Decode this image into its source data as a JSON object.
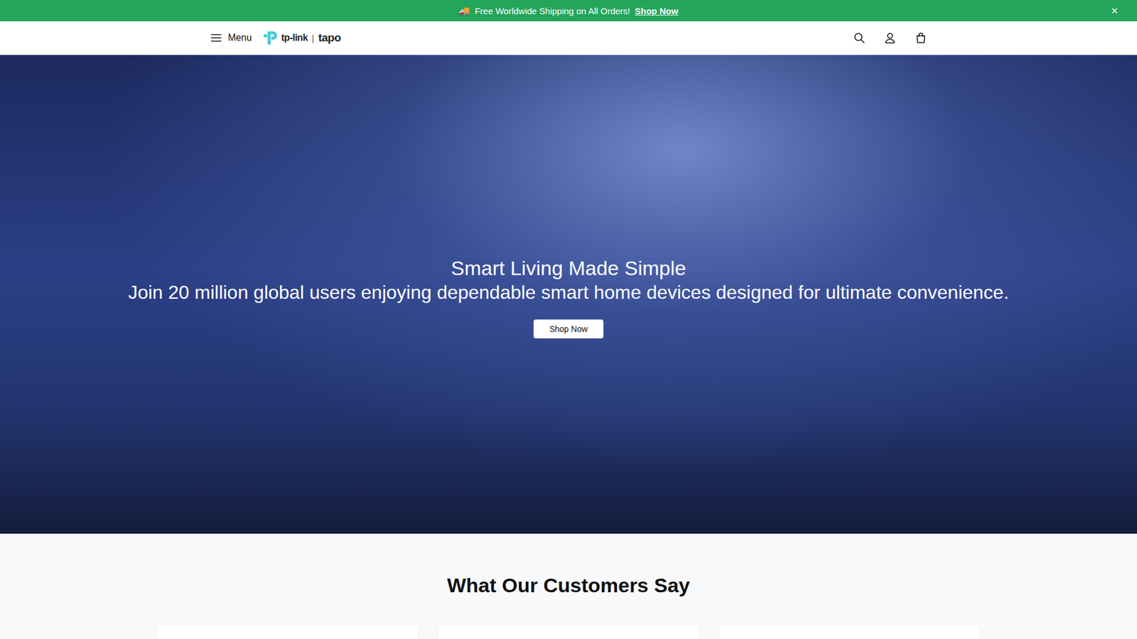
{
  "announcement": {
    "icon": "🚚",
    "text": "Free Worldwide Shipping on All Orders!",
    "link": "Shop Now",
    "close": "×"
  },
  "header": {
    "menu_label": "Menu",
    "logo": {
      "brand": "tp-link",
      "separator": "|",
      "product": "tapo"
    }
  },
  "hero": {
    "title": "Smart Living Made Simple",
    "subtitle": "Join 20 million global users enjoying dependable smart home devices designed for ultimate convenience.",
    "button": "Shop Now"
  },
  "testimonials": {
    "heading": "What Our Customers Say"
  }
}
